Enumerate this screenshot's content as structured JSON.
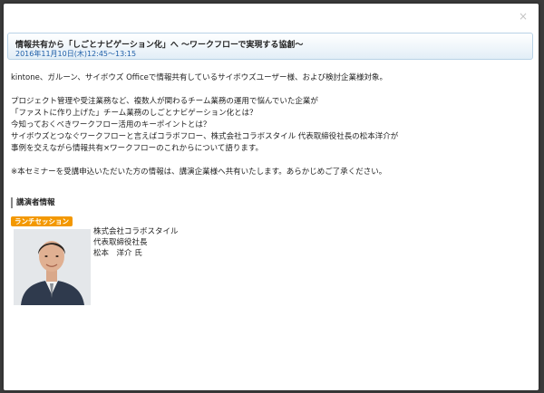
{
  "modal": {
    "close_glyph": "×"
  },
  "event": {
    "title": "情報共有から「しごとナビゲーション化」へ 〜ワークフローで実現する協創〜",
    "date": "2016年11月10日(木)12:45〜13:15"
  },
  "body": {
    "target": "kintone、ガルーン、サイボウズ Officeで情報共有しているサイボウズユーザー様、および検討企業様対象。",
    "lines": [
      "プロジェクト管理や受注業務など、複数人が関わるチーム業務の運用で悩んでいた企業が",
      "「ファストに作り上げた」チーム業務のしごとナビゲーション化とは？",
      "今知っておくべきワークフロー活用のキーポイントとは？",
      "サイボウズとつなぐワークフローと言えばコラボフロー、株式会社コラボスタイル 代表取締役社長の松本洋介が",
      "事例を交えながら情報共有×ワークフローのこれからについて語ります。"
    ],
    "notice": "※本セミナーを受講申込いただいた方の情報は、講演企業様へ共有いたします。あらかじめご了承ください。"
  },
  "speaker": {
    "heading": "講演者情報",
    "badge": "ランチセッション",
    "company": "株式会社コラボスタイル",
    "role": "代表取締役社長",
    "name": "松本　洋介 氏"
  },
  "colors": {
    "badge": "#f39800",
    "date": "#1f5fa8",
    "header_border": "#b8d2e6"
  }
}
